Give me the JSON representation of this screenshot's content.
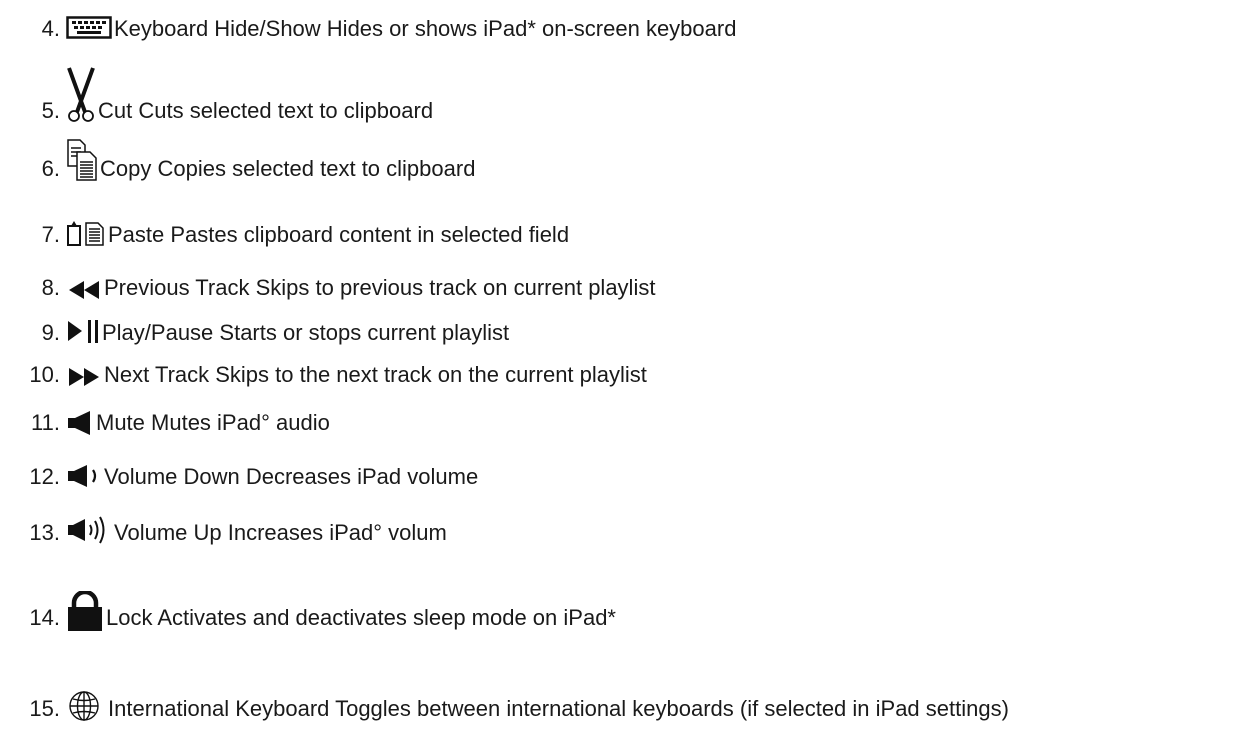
{
  "items": [
    {
      "num": "4.",
      "icon": "keyboard-icon",
      "text": "Keyboard Hide/Show Hides or shows iPad* on-screen keyboard"
    },
    {
      "num": "5.",
      "icon": "scissors-icon",
      "text": "Cut Cuts selected text to clipboard"
    },
    {
      "num": "6.",
      "icon": "copy-icon",
      "text": "Copy Copies selected text to clipboard"
    },
    {
      "num": "7.",
      "icon": "paste-icon",
      "text": "Paste Pastes clipboard content in selected field"
    },
    {
      "num": "8.",
      "icon": "previous-track-icon",
      "text": "Previous Track Skips to previous track on current playlist"
    },
    {
      "num": "9.",
      "icon": "play-pause-icon",
      "text": "Play/Pause Starts or stops current playlist"
    },
    {
      "num": "10.",
      "icon": "next-track-icon",
      "text": "Next Track Skips to the next track on the current playlist"
    },
    {
      "num": "11.",
      "icon": "mute-icon",
      "text": "Mute Mutes iPad° audio"
    },
    {
      "num": "12.",
      "icon": "volume-down-icon",
      "text": "Volume Down Decreases iPad volume"
    },
    {
      "num": "13.",
      "icon": "volume-up-icon",
      "text": "Volume Up Increases iPad° volum"
    },
    {
      "num": "14.",
      "icon": "lock-icon",
      "text": "Lock Activates and deactivates sleep mode on iPad*"
    },
    {
      "num": "15.",
      "icon": "globe-icon",
      "text": "International Keyboard Toggles between international keyboards (if selected in iPad settings)"
    }
  ]
}
